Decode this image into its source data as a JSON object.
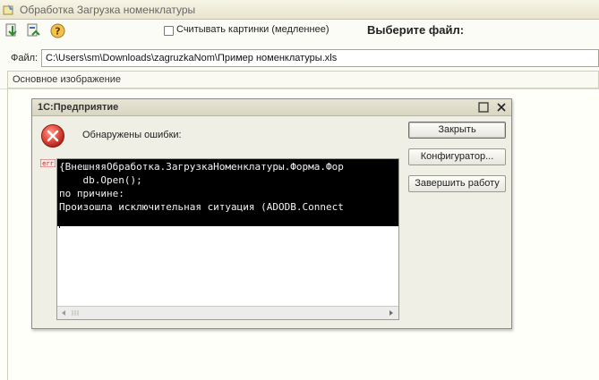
{
  "window": {
    "title": "Обработка  Загрузка номенклатуры"
  },
  "toolbar": {
    "load_pictures_label": "Считывать картинки (медленнее)",
    "load_pictures_checked": false,
    "choose_file_label": "Выберите файл:"
  },
  "file": {
    "label": "Файл:",
    "value": "C:\\Users\\sm\\Downloads\\zagruzkaNom\\Пример номенклатуры.xls"
  },
  "group": {
    "title": "Основное изображение"
  },
  "dialog": {
    "title": "1С:Предприятие",
    "message": "Обнаружены ошибки:",
    "error_tag": "err",
    "lines": [
      "{ВнешняяОбработка.ЗагрузкаНоменклатуры.Форма.Фор",
      "    db.Open();",
      "по причине:",
      "Произошла исключительная ситуация (ADODB.Connect"
    ],
    "buttons": {
      "close": "Закрыть",
      "configurator": "Конфигуратор...",
      "exit": "Завершить работу"
    }
  },
  "colors": {
    "error_red": "#d9443a",
    "code_bg": "#000000",
    "code_fg": "#f2f2f2"
  }
}
